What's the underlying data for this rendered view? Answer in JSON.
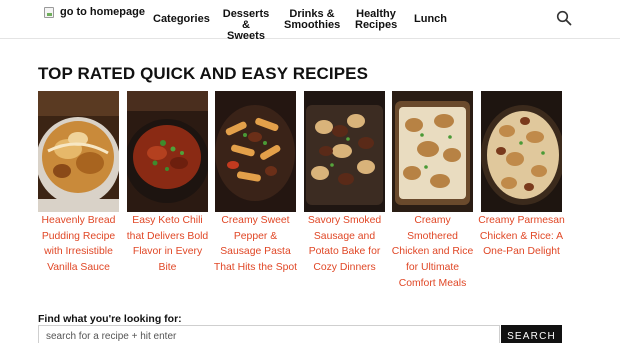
{
  "header": {
    "logo_alt": "go to homepage",
    "nav": {
      "categories": "Categories",
      "desserts": "Desserts\n& Sweets",
      "drinks": "Drinks &\nSmoothies",
      "healthy": "Healthy\nRecipes",
      "lunch": "Lunch"
    },
    "search_icon": "magnifier-icon"
  },
  "main": {
    "title": "TOP RATED QUICK AND EASY RECIPES",
    "recipes": [
      {
        "title": "Heavenly Bread Pudding Recipe with Irresistible Vanilla Sauce"
      },
      {
        "title": "Easy Keto Chili that Delivers Bold Flavor in Every Bite"
      },
      {
        "title": "Creamy Sweet Pepper & Sausage Pasta That Hits the Spot"
      },
      {
        "title": "Savory Smoked Sausage and Potato Bake for Cozy Dinners"
      },
      {
        "title": "Creamy Smothered Chicken and Rice for Ultimate Comfort Meals"
      },
      {
        "title": "Creamy Parmesan Chicken & Rice: A One-Pan Delight"
      }
    ]
  },
  "search": {
    "label": "Find what you're looking for:",
    "placeholder": "search for a recipe + hit enter",
    "button": "SEARCH"
  },
  "colors": {
    "link": "#e04726",
    "button_bg": "#111111",
    "border": "#e4e4e4"
  }
}
